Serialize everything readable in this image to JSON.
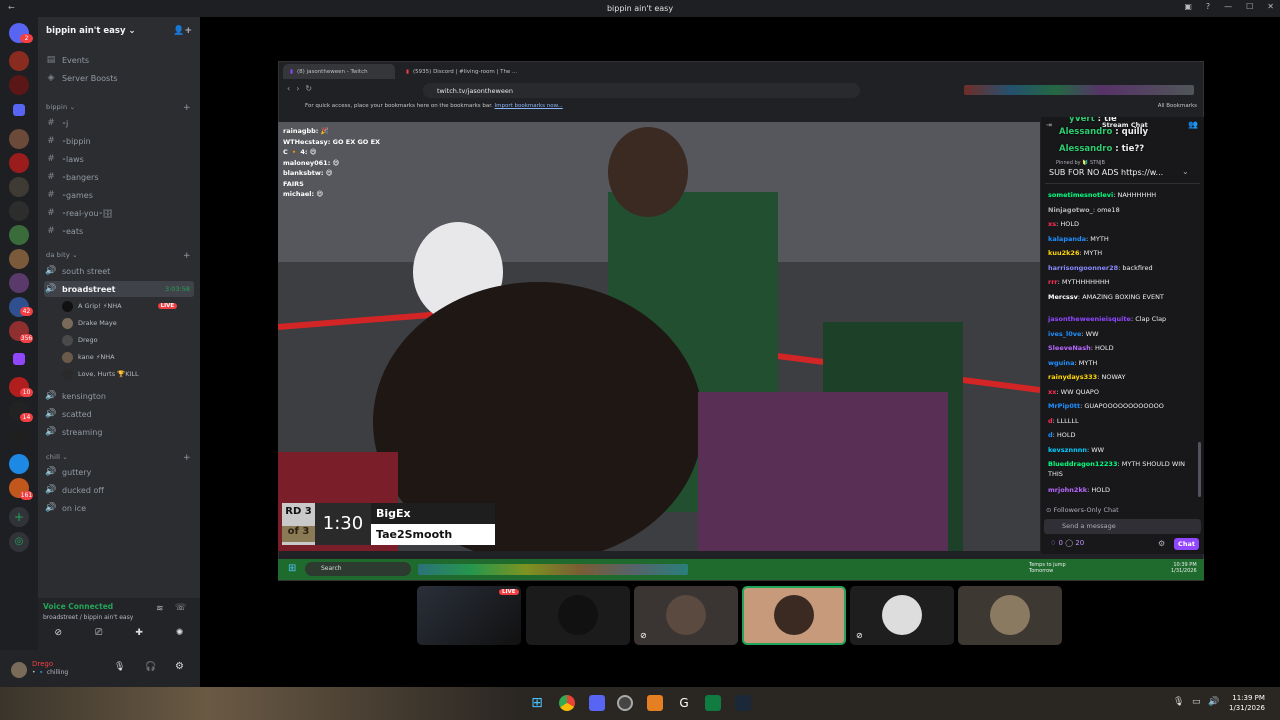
{
  "window": {
    "title": "bippin ain't easy"
  },
  "guild": {
    "name": "bippin ain't easy ⌄"
  },
  "server_badges": [
    "2",
    "42",
    "356",
    "10",
    "14",
    "161"
  ],
  "nav": [
    {
      "label": "Events"
    },
    {
      "label": "Server Boosts"
    }
  ],
  "categories": {
    "bippin": "bippin ⌄",
    "da_bity": "da bity ⌄",
    "chill": "chill ⌄"
  },
  "bippin_channels": [
    "⁃j",
    "⁃bippin",
    "⁃laws",
    "⁃bangers",
    "⁃games",
    "⁃real-you⁃🗄",
    "⁃eats"
  ],
  "dabity_channels": {
    "south_street": "south street",
    "broadstreet": "broadstreet",
    "broadstreet_time": "3:03:58",
    "kensington": "kensington",
    "scatted": "scatted",
    "streaming": "streaming"
  },
  "voice_users": [
    {
      "name": "A Grip! ⚡NHA",
      "live": "LIVE"
    },
    {
      "name": "Drake Maye"
    },
    {
      "name": "Drego"
    },
    {
      "name": "kane ⚡NHA"
    },
    {
      "name": "Love, Hurts 🏆KILL"
    }
  ],
  "chill_channels": [
    "guttery",
    "ducked off",
    "on ice"
  ],
  "voice": {
    "status": "Voice Connected",
    "location": "broadstreet / bippin ain't easy"
  },
  "user": {
    "name": "Drego",
    "status": "• 🔹 chilling"
  },
  "browser": {
    "tab1": "(8) jasontheween - Twitch",
    "tab2": "(5935) Discord | #living-room | The ...",
    "url": "twitch.tv/jasontheween",
    "bookmarks_hint": "For quick access, place your bookmarks here on the bookmarks bar.",
    "bookmarks_link": "Import bookmarks now...",
    "all_bookmarks": "All Bookmarks"
  },
  "video_chat": [
    "rainagbb: 🎉",
    "WTHecstasy: GO EX GO EX",
    "C 🔸 4: 😄",
    "maloney061: 😄",
    "blanksbtw: 😄",
    "FAIRS",
    "michael: 😄"
  ],
  "scoreboard": {
    "round": "RD 3",
    "of": "of 3",
    "time": "1:30",
    "fighter1": "BigEx",
    "fighter2": "Tae2Smooth"
  },
  "twitch_chat": {
    "header": "Stream Chat",
    "pinned": [
      {
        "user": "yVert",
        "msg": "tie"
      },
      {
        "user": "Alessandro",
        "msg": "quilly"
      },
      {
        "user": "Alessandro",
        "msg": "tie??"
      }
    ],
    "pinned_by": "Pinned by 🔰 STNJB",
    "ad": "SUB FOR NO ADS https://w...",
    "messages": [
      {
        "user": "sometimesnotlevi",
        "msg": "NAHHHHHH"
      },
      {
        "user": "Ninjagotwo_",
        "msg": "ome18"
      },
      {
        "user": "xs",
        "msg": "HOLD"
      },
      {
        "user": "kalapanda",
        "msg": "MYTH"
      },
      {
        "user": "kuu2k26",
        "msg": "MYTH"
      },
      {
        "user": "harrisongoonner28",
        "msg": "backfired"
      },
      {
        "user": "rrr",
        "msg": "MYTHHHHHHH"
      },
      {
        "user": "Mercssv",
        "msg": "AMAZING BOXING EVENT"
      },
      {
        "user": "jasontheweenieisquite",
        "msg": "Clap Clap"
      },
      {
        "user": "ives_l0ve",
        "msg": "WW"
      },
      {
        "user": "SleeveNash",
        "msg": "HOLD"
      },
      {
        "user": "wguina",
        "msg": "MYTH"
      },
      {
        "user": "rainydays333",
        "msg": "NOWAY"
      },
      {
        "user": "xx",
        "msg": "WW QUAPO"
      },
      {
        "user": "MrPip0tt",
        "msg": "GUAPOOOOOOOOOOOO"
      },
      {
        "user": "d",
        "msg": "LLLLLL"
      },
      {
        "user": "d",
        "msg": "HOLD"
      },
      {
        "user": "kevsznnnn",
        "msg": "WW"
      },
      {
        "user": "Blueddragon12233",
        "msg": "MYTH SHOULD WIN"
      },
      {
        "user": "",
        "msg": "THIS"
      },
      {
        "user": "mrjohn2kk",
        "msg": "HOLD"
      }
    ],
    "followers_only": "Followers-Only Chat",
    "input_placeholder": "Send a message",
    "points": "0",
    "viewers": "20",
    "chat_button": "Chat"
  },
  "inner_taskbar": {
    "search": "Search",
    "weather1": "Temps to jump",
    "weather2": "Tomorrow",
    "time": "10:39 PM",
    "date": "1/31/2026"
  },
  "tiles": [
    {
      "live": "LIVE"
    }
  ],
  "taskbar": {
    "time": "11:39 PM",
    "date": "1/31/2026"
  },
  "colors": {
    "discord_green": "#23a559",
    "twitch_purple": "#9147ff",
    "live_red": "#f23f43"
  }
}
